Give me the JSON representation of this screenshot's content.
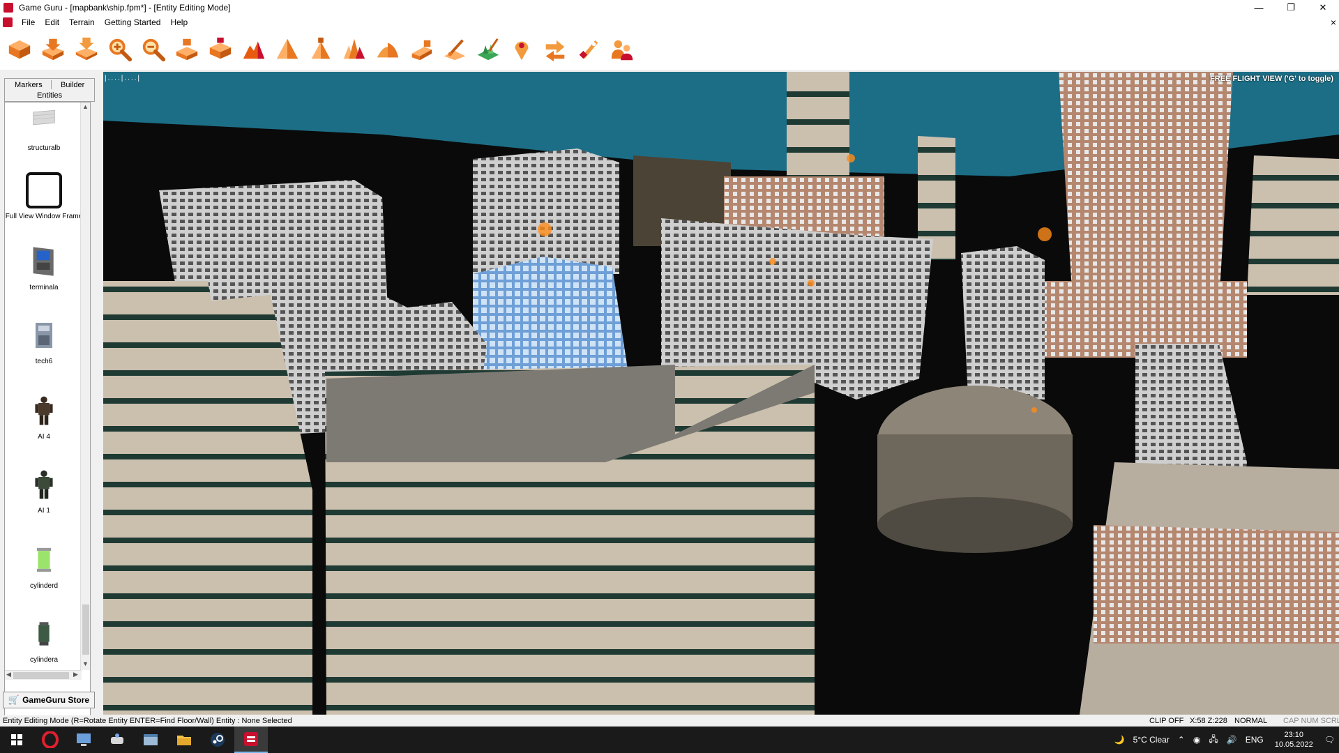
{
  "window": {
    "title": "Game Guru - [mapbank\\ship.fpm*] - [Entity Editing Mode]",
    "minimize": "—",
    "maximize": "❐",
    "close": "✕"
  },
  "menu": {
    "items": [
      "File",
      "Edit",
      "Terrain",
      "Getting Started",
      "Help"
    ],
    "mdi_close": "×"
  },
  "toolbar": {
    "tools": [
      "new-level-icon",
      "open-level-icon",
      "save-level-icon",
      "zoom-in-icon",
      "zoom-out-icon",
      "terrain-raise-icon",
      "terrain-lower-icon",
      "terrain-mountain-icon",
      "terrain-blend-icon",
      "terrain-ramp-icon",
      "terrain-peaks-icon",
      "terrain-dome-icon",
      "terrain-flatten-icon",
      "terrain-paint-icon",
      "grass-paint-icon",
      "waypoint-icon",
      "entity-move-icon",
      "test-game-icon",
      "social-vr-icon"
    ]
  },
  "sidebar": {
    "tabs": {
      "markers": "Markers",
      "builder": "Builder",
      "entities": "Entities"
    },
    "entities": [
      {
        "label": "structuralb"
      },
      {
        "label": "Full View Window Frame"
      },
      {
        "label": "terminala"
      },
      {
        "label": "tech6"
      },
      {
        "label": "AI 4"
      },
      {
        "label": "AI 1"
      },
      {
        "label": "cylinderd"
      },
      {
        "label": "cylindera"
      }
    ],
    "store_button": "GameGuru Store"
  },
  "viewport": {
    "ruler": "|....|....|",
    "flight_view": "FREE FLIGHT VIEW ('G' to toggle)"
  },
  "statusbar": {
    "mode": "Entity Editing Mode (R=Rotate Entity  ENTER=Find Floor/Wall)  Entity : None Selected",
    "clip": "CLIP OFF",
    "coords": "X:58  Z:228",
    "normal": "NORMAL",
    "keys": "CAP NUM SCRL"
  },
  "taskbar": {
    "weather": "5°C  Clear",
    "language": "ENG",
    "time": "23:10",
    "date": "10.05.2022"
  },
  "colors": {
    "accent": "#c8102e",
    "sky": "#1c6e86",
    "ground": "#0a0a0a"
  }
}
